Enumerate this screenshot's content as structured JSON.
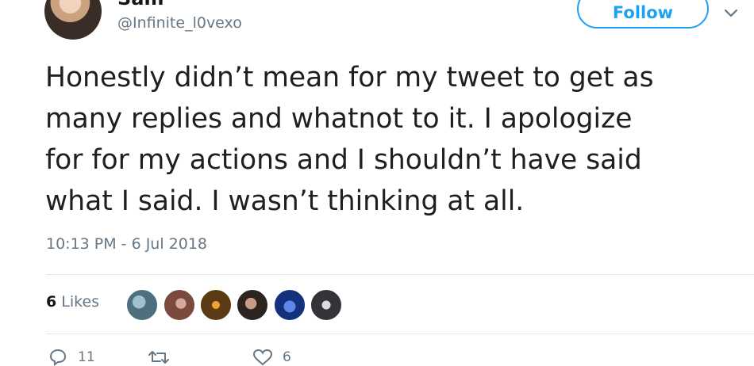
{
  "author": {
    "display_name": "Sam",
    "handle": "@Infinite_l0vexo"
  },
  "follow_button": {
    "label": "Follow"
  },
  "tweet": {
    "lines": [
      "Honestly didn’t mean for my tweet to get as",
      "many replies and whatnot to it. I apologize",
      "for for my actions and I shouldn’t have said",
      "what I said. I wasn’t thinking at all."
    ],
    "timestamp": "10:13 PM - 6 Jul 2018"
  },
  "stats": {
    "likes_count": "6",
    "likes_label": "Likes"
  },
  "likers": [
    {
      "icon": "avatar-1",
      "color": "#5a7d8c"
    },
    {
      "icon": "avatar-2",
      "color": "#8a5a4e"
    },
    {
      "icon": "avatar-3",
      "color": "#6b4a1f"
    },
    {
      "icon": "avatar-4",
      "color": "#3b2f2a"
    },
    {
      "icon": "avatar-5",
      "color": "#1f3f9a"
    },
    {
      "icon": "avatar-6",
      "color": "#4a4a52"
    }
  ],
  "actions": {
    "reply_count": "11",
    "retweet_count": "",
    "like_count": "6"
  },
  "colors": {
    "accent": "#1da1f2",
    "text": "#1c2022",
    "muted": "#657786",
    "divider": "#e1e8ed"
  }
}
